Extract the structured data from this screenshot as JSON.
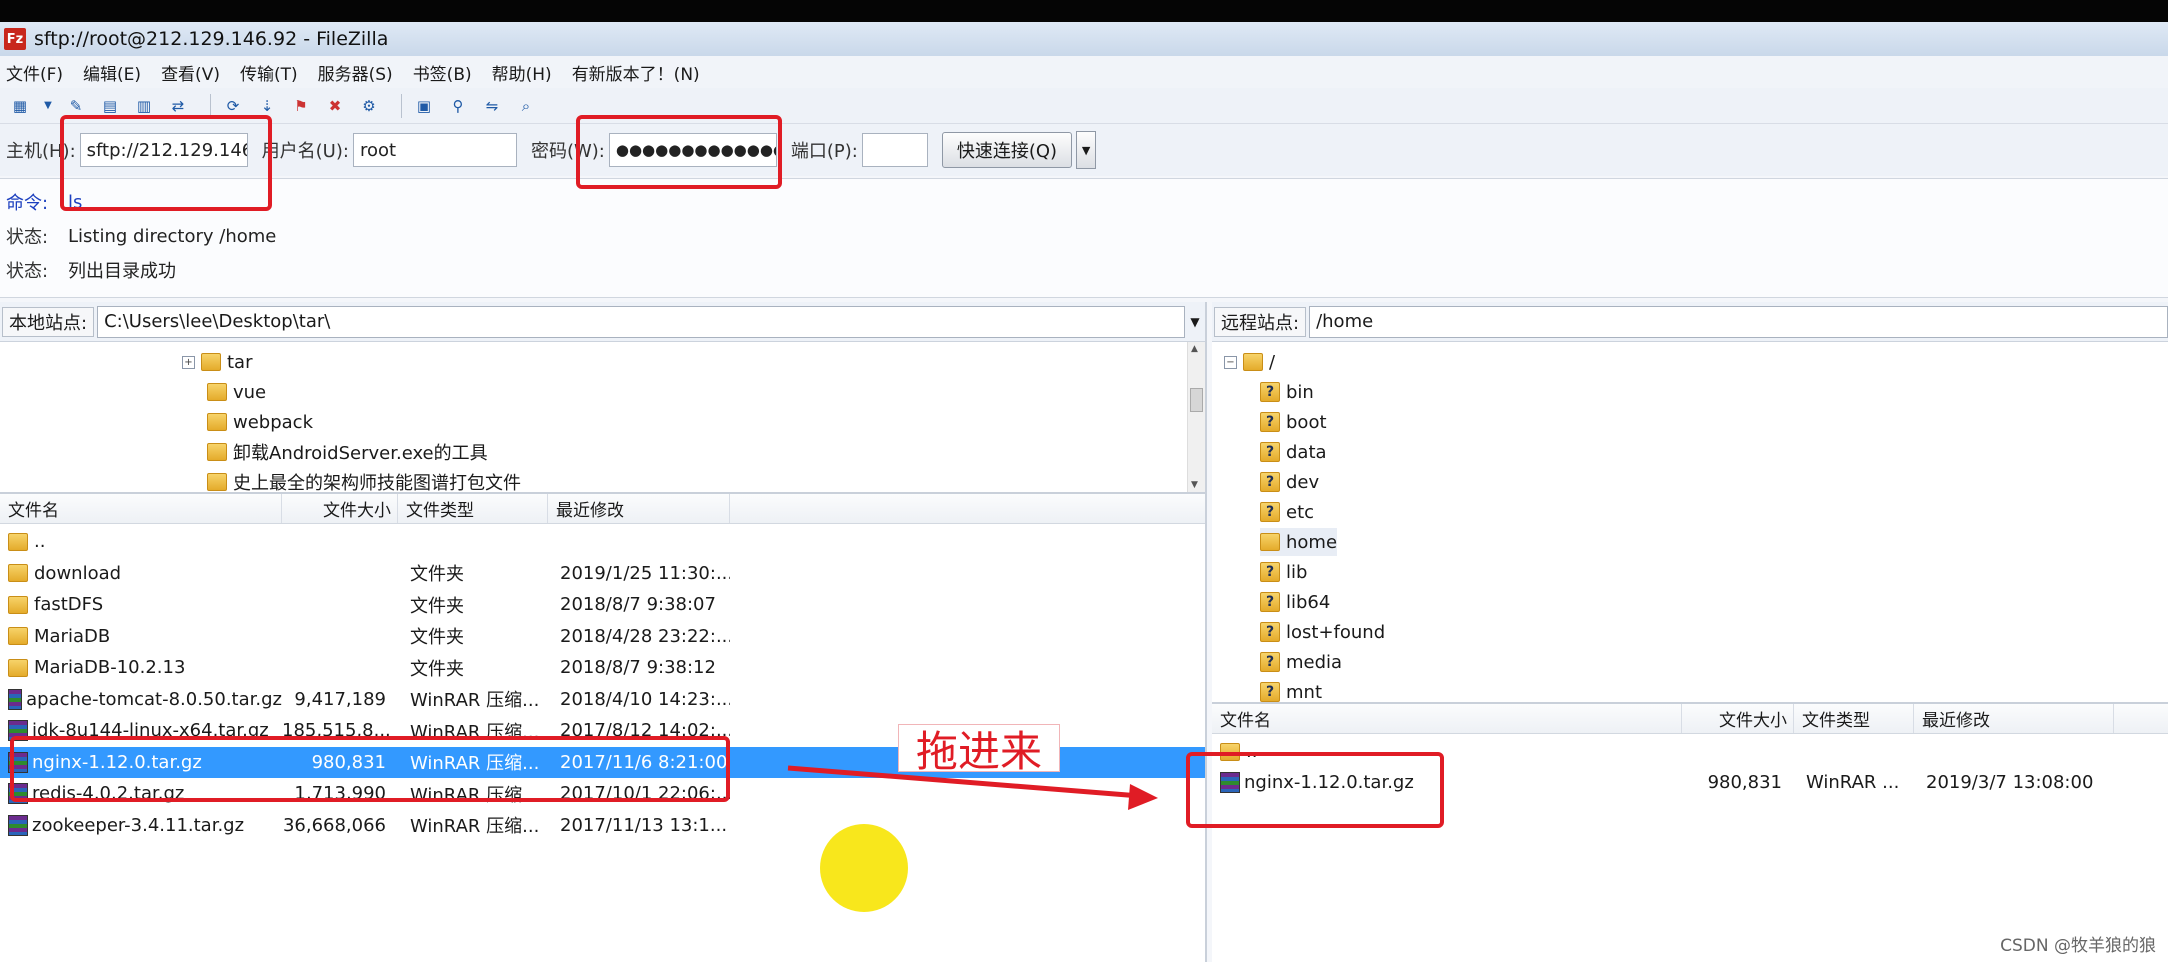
{
  "window": {
    "title": "sftp://root@212.129.146.92 - FileZilla",
    "app_icon": "Fz"
  },
  "menu": [
    "文件(F)",
    "编辑(E)",
    "查看(V)",
    "传输(T)",
    "服务器(S)",
    "书签(B)",
    "帮助(H)",
    "有新版本了！(N)"
  ],
  "quickconnect": {
    "host_label": "主机(H):",
    "host_value": "sftp://212.129.146",
    "user_label": "用户名(U):",
    "user_value": "root",
    "pass_label": "密码(W):",
    "pass_value": "●●●●●●●●●●●●●●",
    "port_label": "端口(P):",
    "port_value": "",
    "connect_label": "快速连接(Q)",
    "dropdown_glyph": "▼"
  },
  "log": [
    {
      "key": "命令:",
      "value": "ls"
    },
    {
      "key": "状态:",
      "value": "Listing directory /home"
    },
    {
      "key": "状态:",
      "value": "列出目录成功"
    }
  ],
  "local": {
    "site_label": "本地站点:",
    "site_path": "C:\\Users\\lee\\Desktop\\tar\\",
    "tree": [
      "tar",
      "vue",
      "webpack",
      "卸载AndroidServer.exe的工具",
      "史上最全的架构师技能图谱打包文件"
    ],
    "headers": {
      "name": "文件名",
      "size": "文件大小",
      "type": "文件类型",
      "modified": "最近修改"
    },
    "files": [
      {
        "name": "..",
        "size": "",
        "type": "",
        "modified": "",
        "kind": "folder"
      },
      {
        "name": "download",
        "size": "",
        "type": "文件夹",
        "modified": "2019/1/25 11:30:...",
        "kind": "folder"
      },
      {
        "name": "fastDFS",
        "size": "",
        "type": "文件夹",
        "modified": "2018/8/7 9:38:07",
        "kind": "folder"
      },
      {
        "name": "MariaDB",
        "size": "",
        "type": "文件夹",
        "modified": "2018/4/28 23:22:...",
        "kind": "folder"
      },
      {
        "name": "MariaDB-10.2.13",
        "size": "",
        "type": "文件夹",
        "modified": "2018/8/7 9:38:12",
        "kind": "folder"
      },
      {
        "name": "apache-tomcat-8.0.50.tar.gz",
        "size": "9,417,189",
        "type": "WinRAR 压缩...",
        "modified": "2018/4/10 14:23:...",
        "kind": "rar"
      },
      {
        "name": "jdk-8u144-linux-x64.tar.gz",
        "size": "185,515,8...",
        "type": "WinRAR 压缩...",
        "modified": "2017/8/12 14:02:...",
        "kind": "rar"
      },
      {
        "name": "nginx-1.12.0.tar.gz",
        "size": "980,831",
        "type": "WinRAR 压缩...",
        "modified": "2017/11/6 8:21:00",
        "kind": "rar",
        "selected": true
      },
      {
        "name": "redis-4.0.2.tar.gz",
        "size": "1,713,990",
        "type": "WinRAR 压缩...",
        "modified": "2017/10/1 22:06:...",
        "kind": "rar"
      },
      {
        "name": "zookeeper-3.4.11.tar.gz",
        "size": "36,668,066",
        "type": "WinRAR 压缩...",
        "modified": "2017/11/13 13:1...",
        "kind": "rar"
      }
    ]
  },
  "remote": {
    "site_label": "远程站点:",
    "site_path": "/home",
    "tree_root": "/",
    "tree": [
      "bin",
      "boot",
      "data",
      "dev",
      "etc",
      "home",
      "lib",
      "lib64",
      "lost+found",
      "media",
      "mnt"
    ],
    "headers": {
      "name": "文件名",
      "size": "文件大小",
      "type": "文件类型",
      "modified": "最近修改"
    },
    "files": [
      {
        "name": "..",
        "size": "",
        "type": "",
        "modified": "",
        "kind": "folder"
      },
      {
        "name": "nginx-1.12.0.tar.gz",
        "size": "980,831",
        "type": "WinRAR ...",
        "modified": "2019/3/7 13:08:00",
        "kind": "rar"
      }
    ]
  },
  "annotation": {
    "text": "拖进来",
    "color": "#e01c25"
  },
  "watermark": "CSDN @牧羊狼的狼"
}
